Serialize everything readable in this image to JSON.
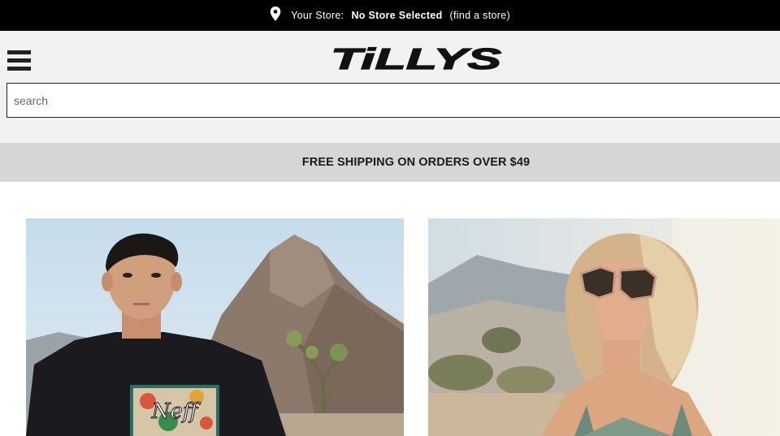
{
  "store_bar": {
    "label": "Your Store:",
    "value": "No Store Selected",
    "link": "(find a store)"
  },
  "header": {
    "logo_text": "TiLLYS",
    "menu_icon": "hamburger-menu-icon"
  },
  "search": {
    "placeholder": "search",
    "value": ""
  },
  "promo": {
    "text": "FREE SHIPPING ON ORDERS OVER $49"
  },
  "hero": {
    "left": {
      "tshirt_text": "Neff"
    }
  },
  "colors": {
    "top_bar": "#000000",
    "header_bg": "#f2f2f2",
    "promo_bg": "#d6d6d6",
    "text_dark": "#1a1a1a"
  }
}
